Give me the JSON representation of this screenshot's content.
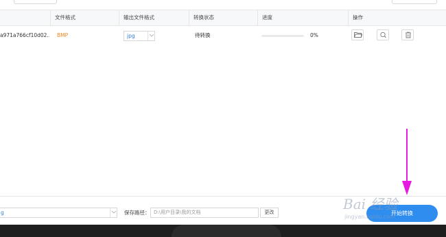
{
  "table": {
    "headers": {
      "format": "文件格式",
      "output_format": "输出文件格式",
      "status": "转换状态",
      "progress": "进度",
      "actions": "操作"
    },
    "rows": [
      {
        "filename": "a971a766cf10d02...",
        "format": "BMP",
        "output_format": "jpg",
        "status": "待转换",
        "progress_text": "0%",
        "progress_value": 0
      }
    ]
  },
  "footer": {
    "left_select_value": "g",
    "save_path_label": "保存路径：",
    "save_path_value": "D:\\用户目录\\我的文档",
    "change_button": "更改",
    "start_button": "开始转换"
  },
  "watermark": {
    "text": "Bai 经验",
    "url": "jingyan.baidu.com"
  },
  "annotation": {
    "arrow_color": "#e619e0"
  },
  "colors": {
    "accent": "#2f8df0",
    "format_text": "#f08a24",
    "link_text": "#2f7ed8"
  },
  "icons": [
    "folder-icon",
    "search-icon",
    "trash-icon",
    "chevron-down-icon"
  ]
}
